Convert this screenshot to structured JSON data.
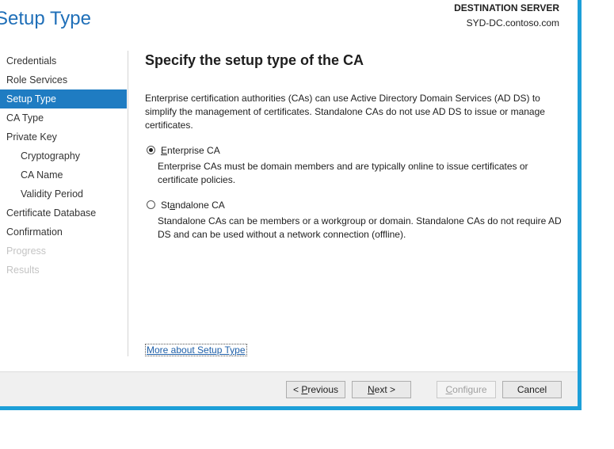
{
  "window": {
    "title": "Setup Type",
    "destination_label": "DESTINATION SERVER",
    "destination_server": "SYD-DC.contoso.com",
    "border_color": "#1d9fd8"
  },
  "nav": {
    "selected_color": "#1f7cc2",
    "items": [
      {
        "label": "Credentials",
        "state": "enabled"
      },
      {
        "label": "Role Services",
        "state": "enabled"
      },
      {
        "label": "Setup Type",
        "state": "selected"
      },
      {
        "label": "CA Type",
        "state": "enabled"
      },
      {
        "label": "Private Key",
        "state": "enabled"
      },
      {
        "label": "Cryptography",
        "state": "enabled",
        "sub": true
      },
      {
        "label": "CA Name",
        "state": "enabled",
        "sub": true
      },
      {
        "label": "Validity Period",
        "state": "enabled",
        "sub": true
      },
      {
        "label": "Certificate Database",
        "state": "enabled"
      },
      {
        "label": "Confirmation",
        "state": "enabled"
      },
      {
        "label": "Progress",
        "state": "disabled"
      },
      {
        "label": "Results",
        "state": "disabled"
      }
    ]
  },
  "main": {
    "heading": "Specify the setup type of the CA",
    "intro": "Enterprise certification authorities (CAs) can use Active Directory Domain Services (AD DS) to simplify the management of certificates. Standalone CAs do not use AD DS to issue or manage certificates.",
    "options": [
      {
        "label_pre": "",
        "label_key": "E",
        "label_post": "nterprise CA",
        "checked": true,
        "description": "Enterprise CAs must be domain members and are typically online to issue certificates or certificate policies."
      },
      {
        "label_pre": "St",
        "label_key": "a",
        "label_post": "ndalone CA",
        "checked": false,
        "description": "Standalone CAs can be members or a workgroup or domain. Standalone CAs do not require AD DS and can be used without a network connection (offline)."
      }
    ],
    "more_link": "More about Setup Type"
  },
  "footer": {
    "previous": {
      "pre": "< ",
      "key": "P",
      "post": "revious"
    },
    "next": {
      "pre": "",
      "key": "N",
      "post": "ext >"
    },
    "configure": {
      "pre": "",
      "key": "C",
      "post": "onfigure",
      "disabled": true
    },
    "cancel": {
      "pre": "Cancel",
      "key": "",
      "post": ""
    }
  }
}
